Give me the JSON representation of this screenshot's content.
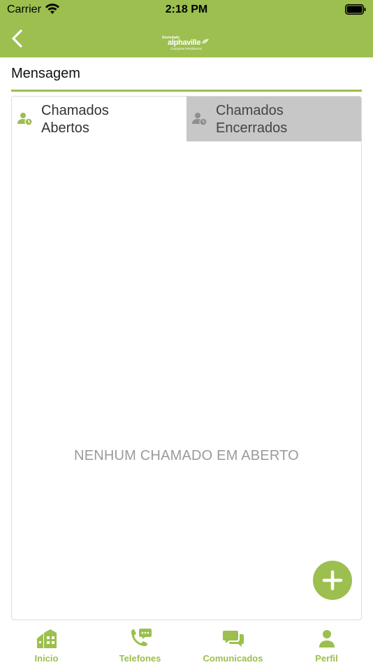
{
  "status_bar": {
    "carrier": "Carrier",
    "time": "2:18 PM",
    "wifi_icon": "wifi-icon",
    "battery_icon": "battery-icon"
  },
  "nav": {
    "back_icon": "chevron-left-icon",
    "logo": {
      "line1": "Sociedade",
      "line2": "alphaville",
      "line3": "Campinas Residencial"
    }
  },
  "page": {
    "title": "Mensagem"
  },
  "tabs": [
    {
      "label": "Chamados\nAbertos",
      "icon": "user-clock-icon",
      "selected": true
    },
    {
      "label": "Chamados\nEncerrados",
      "icon": "user-clock-icon",
      "selected": false
    }
  ],
  "empty_message": "NENHUM CHAMADO EM ABERTO",
  "fab": {
    "icon": "plus-icon"
  },
  "tabbar": {
    "items": [
      {
        "label": "Inicio",
        "icon": "home-icon"
      },
      {
        "label": "Telefones",
        "icon": "phone-chat-icon"
      },
      {
        "label": "Comunicados",
        "icon": "chat-bubbles-icon"
      },
      {
        "label": "Perfil",
        "icon": "user-icon"
      }
    ]
  },
  "colors": {
    "brand_green": "#9cbf4f",
    "tab_inactive_bg": "#c7c7c7",
    "empty_text": "#9a9a9a"
  }
}
